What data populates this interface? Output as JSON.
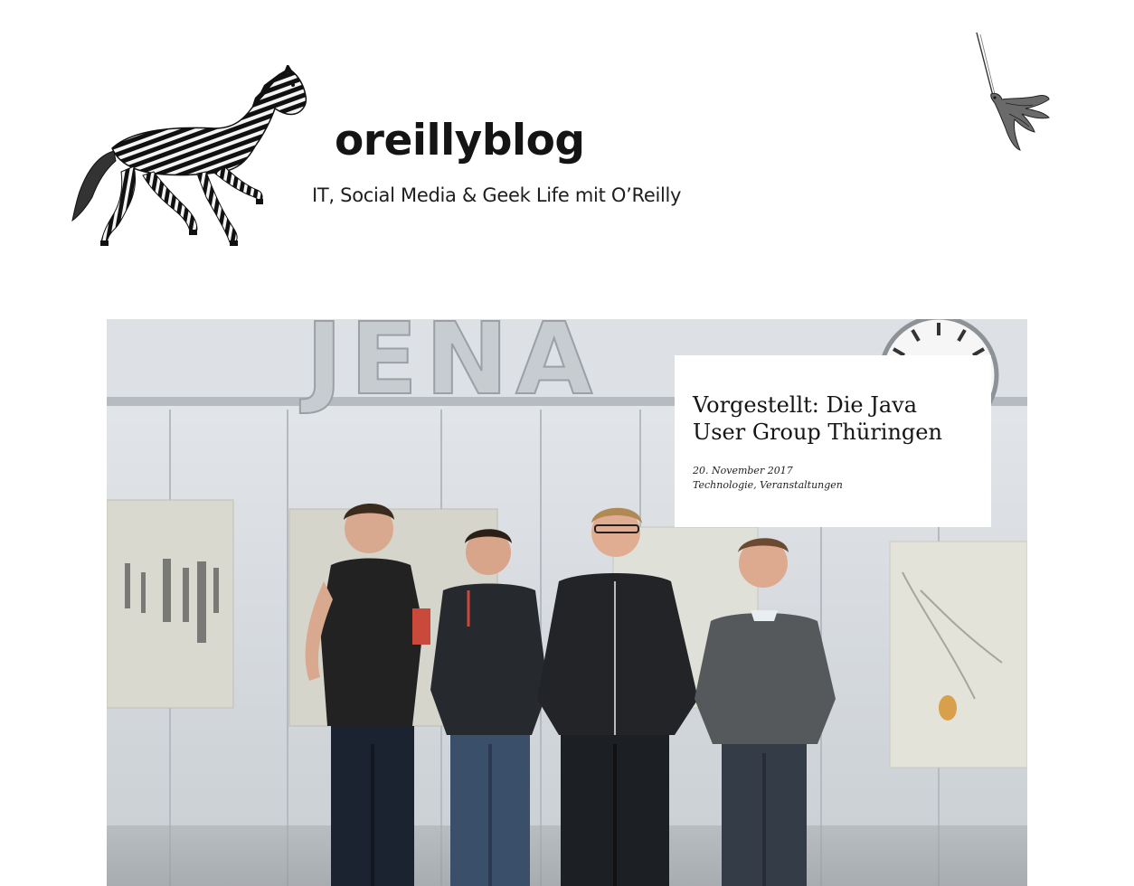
{
  "site": {
    "title": "oreillyblog",
    "tagline": "IT, Social Media & Geek Life mit O’Reilly",
    "logo_icon": "zebra-icon",
    "ornament_icon": "hummingbird-icon"
  },
  "featured_post": {
    "title": "Vorgestellt: Die Java User Group Thüringen",
    "date": "20. November 2017",
    "categories": [
      "Technologie",
      "Veranstaltungen"
    ],
    "category_separator": ", ",
    "image_sign_text": "JENA",
    "colors": {
      "wall": "#d7dbdf",
      "ceiling": "#e9ecef",
      "card_background": "#ffffff"
    }
  }
}
